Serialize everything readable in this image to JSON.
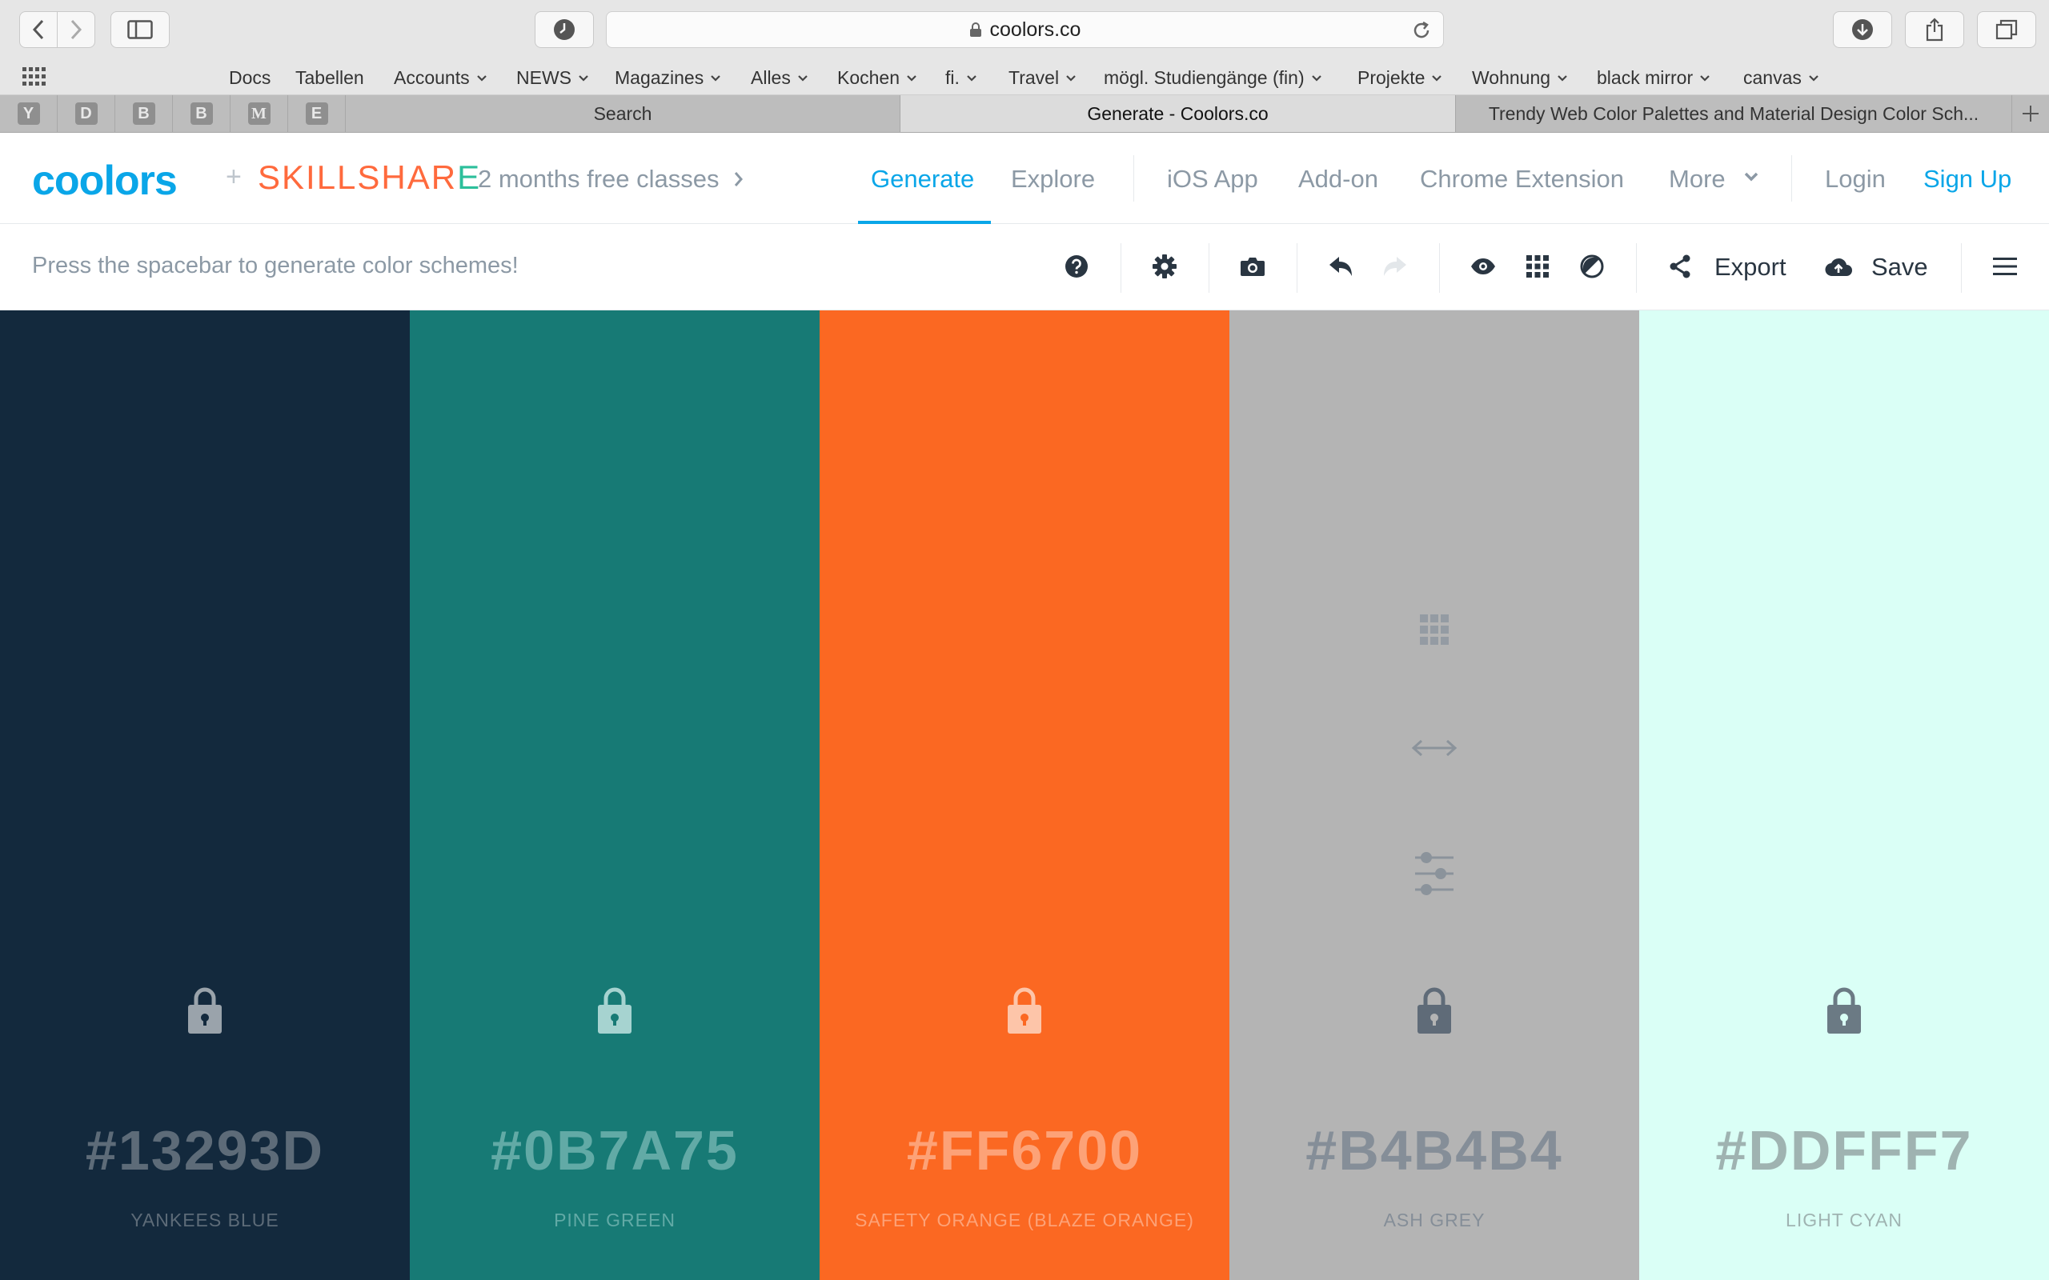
{
  "browser": {
    "url": "coolors.co",
    "bookmarks": [
      "Docs",
      "Tabellen",
      "Accounts",
      "NEWS",
      "Magazines",
      "Alles",
      "Kochen",
      "fi.",
      "Travel",
      "mögl. Studiengänge (fin)",
      "Projekte",
      "Wohnung",
      "black mirror",
      "canvas"
    ],
    "pinned_tabs": [
      "Y",
      "D",
      "B",
      "B",
      "M",
      "E"
    ],
    "tabs": [
      "Search",
      "Generate - Coolors.co",
      "Trendy Web Color Palettes and Material Design Color Sch..."
    ]
  },
  "header": {
    "logo": "coolors",
    "plus": "+",
    "partner_logo_a": "SKILLSHAR",
    "partner_logo_b": "E",
    "promo": "2 months free classes",
    "nav": {
      "generate": "Generate",
      "explore": "Explore",
      "ios_app": "iOS App",
      "addon": "Add-on",
      "chrome_extension": "Chrome Extension",
      "more": "More",
      "login": "Login",
      "signup": "Sign Up"
    }
  },
  "toolbar": {
    "hint": "Press the spacebar to generate color schemes!",
    "export": "Export",
    "save": "Save"
  },
  "palette": [
    {
      "hex": "#13293D",
      "name": "YANKEES BLUE",
      "bg": "#13293d",
      "text": "#5d6b78",
      "lock": "#9aa3ab"
    },
    {
      "hex": "#0B7A75",
      "name": "PINE GREEN",
      "bg": "#177a75",
      "text": "#62aaa6",
      "lock": "#a6d3d0"
    },
    {
      "hex": "#FF6700",
      "name": "SAFETY ORANGE (BLAZE ORANGE)",
      "bg": "#fb6822",
      "text": "#fda277",
      "lock": "#fdc5a9"
    },
    {
      "hex": "#B4B4B4",
      "name": "ASH GREY",
      "bg": "#b4b4b4",
      "text": "#858e98",
      "lock": "#5f6b78"
    },
    {
      "hex": "#DDFFF7",
      "name": "LIGHT CYAN",
      "bg": "#dafff6",
      "text": "#9fb3b1",
      "lock": "#6b7a84"
    }
  ],
  "colors": {
    "accent": "#0aa6e8",
    "muted_text": "#8c99a5",
    "dark_text": "#2a3642"
  }
}
